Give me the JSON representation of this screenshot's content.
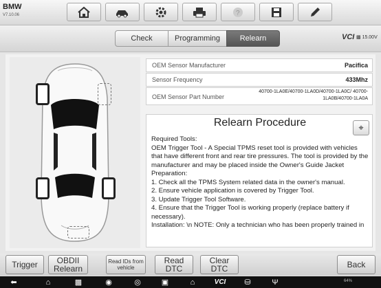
{
  "app": {
    "brand": "BMW",
    "version": "V7.10.06"
  },
  "toolbar": {
    "icons": [
      "home-icon",
      "vehicle-swap-icon",
      "settings-gear-icon",
      "print-icon",
      "help-icon",
      "save-icon",
      "pen-icon"
    ]
  },
  "tabs": [
    {
      "label": "Check",
      "active": false
    },
    {
      "label": "Programming",
      "active": false
    },
    {
      "label": "Relearn",
      "active": true
    }
  ],
  "vci": {
    "label": "VCI",
    "voltage": "15.00V"
  },
  "info": {
    "manufacturer_label": "OEM Sensor Manufacturer",
    "manufacturer_value": "Pacifica",
    "frequency_label": "Sensor Frequency",
    "frequency_value": "433Mhz",
    "part_label": "OEM Sensor Part Number",
    "part_value": "40700-1LA0E/40700-1LA0D/40700-1LA0C/ 40700-1LA0B/40700-1LA0A"
  },
  "procedure": {
    "title": "Relearn Procedure",
    "text": "Required Tools:\nOEM Trigger Tool - A Special TPMS reset tool is provided with vehicles that have different front and rear tire pressures. The tool is provided by the manufacturer and may be placed inside the Owner's Guide Jacket Preparation:\n1. Check all the TPMS System related data in the owner's manual.\n2. Ensure vehicle application is covered by Trigger Tool.\n3. Update Trigger Tool Software.\n4. Ensure that the Trigger Tool is working properly (replace battery if necessary).\nInstallation: \\n NOTE: Only a technician who has been properly trained in"
  },
  "buttons": {
    "trigger": "Trigger",
    "obdii_relearn": "OBDII Relearn",
    "read_ids": "Read IDs from vehicle",
    "read_dtc": "Read DTC",
    "clear_dtc": "Clear DTC",
    "back": "Back"
  },
  "navbar": {
    "icons": [
      "back-arrow-icon",
      "home-icon",
      "recent-apps-icon",
      "chrome-icon",
      "camera-icon",
      "screenshot-icon",
      "maxisys-home-icon",
      "vci-icon",
      "car-icon",
      "usb-icon"
    ],
    "status": "64%"
  }
}
